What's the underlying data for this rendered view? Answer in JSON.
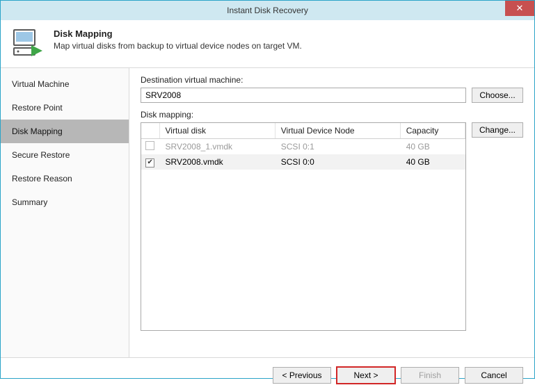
{
  "window": {
    "title": "Instant Disk Recovery",
    "close_glyph": "✕"
  },
  "header": {
    "title": "Disk Mapping",
    "subtitle": "Map virtual disks from backup to virtual device nodes on target VM."
  },
  "sidebar": {
    "items": [
      {
        "label": "Virtual Machine"
      },
      {
        "label": "Restore Point"
      },
      {
        "label": "Disk Mapping"
      },
      {
        "label": "Secure Restore"
      },
      {
        "label": "Restore Reason"
      },
      {
        "label": "Summary"
      }
    ],
    "active_index": 2
  },
  "content": {
    "dest_label": "Destination virtual machine:",
    "dest_value": "SRV2008",
    "choose_label": "Choose...",
    "map_label": "Disk mapping:",
    "change_label": "Change...",
    "columns": {
      "c0": "",
      "c1": "Virtual disk",
      "c2": "Virtual Device Node",
      "c3": "Capacity"
    },
    "rows": [
      {
        "checked": false,
        "enabled": false,
        "vdisk": "SRV2008_1.vmdk",
        "node": "SCSI 0:1",
        "cap": "40 GB"
      },
      {
        "checked": true,
        "enabled": true,
        "vdisk": "SRV2008.vmdk",
        "node": "SCSI 0:0",
        "cap": "40 GB"
      }
    ]
  },
  "footer": {
    "previous": "< Previous",
    "next": "Next >",
    "finish": "Finish",
    "cancel": "Cancel"
  }
}
